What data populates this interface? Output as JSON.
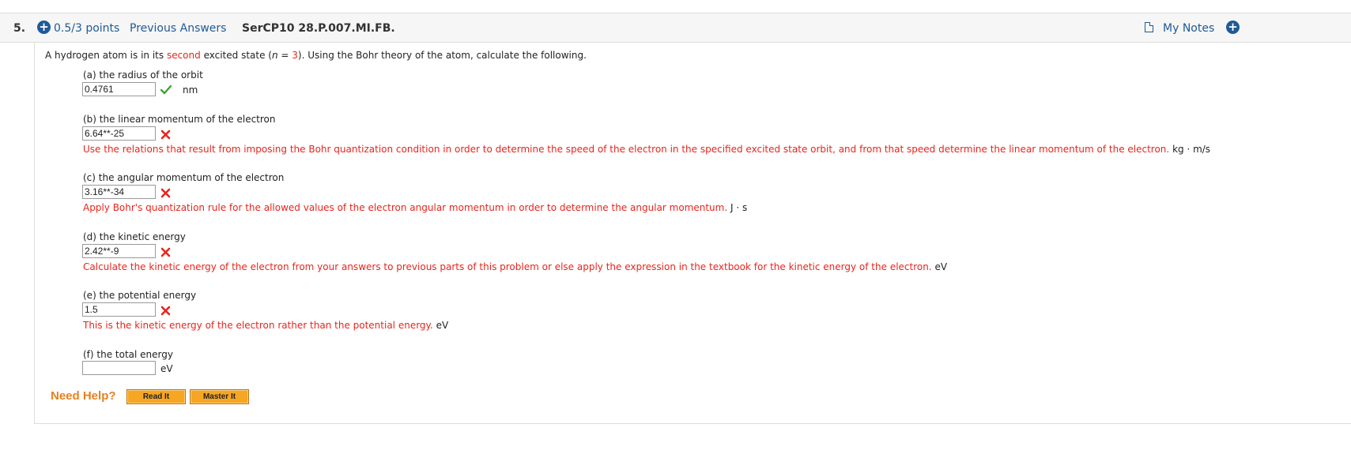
{
  "header": {
    "question_number": "5.",
    "points": "0.5/3 points",
    "previous_answers": "Previous Answers",
    "code": "SerCP10 28.P.007.MI.FB.",
    "my_notes": "My Notes"
  },
  "intro": {
    "before": "A hydrogen atom is in its ",
    "highlight": "second",
    "middle": " excited state (",
    "n_var": "n",
    "eq": " = ",
    "n_value": "3",
    "after": "). Using the Bohr theory of the atom, calculate the following."
  },
  "parts": {
    "a": {
      "label": "(a) the radius of the orbit",
      "value": "0.4761",
      "status": "correct",
      "unit": "nm"
    },
    "b": {
      "label": "(b) the linear momentum of the electron",
      "value": "6.64**-25",
      "status": "incorrect",
      "feedback": "Use the relations that result from imposing the Bohr quantization condition in order to determine the speed of the electron in the specified excited state orbit, and from that speed determine the linear momentum of the electron.",
      "unit": "kg · m/s"
    },
    "c": {
      "label": "(c) the angular momentum of the electron",
      "value": "3.16**-34",
      "status": "incorrect",
      "feedback": "Apply Bohr's quantization rule for the allowed values of the electron angular momentum in order to determine the angular momentum.",
      "unit": "J · s"
    },
    "d": {
      "label": "(d) the kinetic energy",
      "value": "2.42**-9",
      "status": "incorrect",
      "feedback": "Calculate the kinetic energy of the electron from your answers to previous parts of this problem or else apply the expression in the textbook for the kinetic energy of the electron.",
      "unit": "eV"
    },
    "e": {
      "label": "(e) the potential energy",
      "value": "1.5",
      "status": "incorrect",
      "feedback": "This is the kinetic energy of the electron rather than the potential energy.",
      "unit": "eV"
    },
    "f": {
      "label": "(f) the total energy",
      "value": "",
      "unit": "eV"
    }
  },
  "help": {
    "need_help": "Need Help?",
    "read_it": "Read It",
    "master_it": "Master It"
  },
  "colors": {
    "link": "#1f5a96",
    "error": "#e8251d",
    "correct": "#3aa335",
    "help_text": "#e8801d",
    "help_button": "#f6a623"
  }
}
